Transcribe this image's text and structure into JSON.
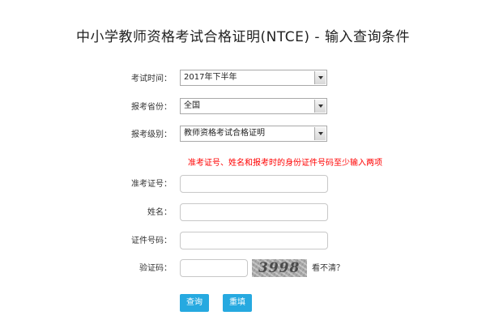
{
  "title": "中小学教师资格考试合格证明(NTCE) - 输入查询条件",
  "form": {
    "exam_time": {
      "label": "考试时间：",
      "selected": "2017年下半年"
    },
    "province": {
      "label": "报考省份：",
      "selected": "全国"
    },
    "level": {
      "label": "报考级别：",
      "selected": "教师资格考试合格证明"
    },
    "hint": "准考证号、姓名和报考时的身份证件号码至少输入两项",
    "ticket_no": {
      "label": "准考证号：",
      "value": ""
    },
    "name": {
      "label": "姓名：",
      "value": ""
    },
    "id_no": {
      "label": "证件号码：",
      "value": ""
    },
    "captcha": {
      "label": "验证码：",
      "value": "",
      "image_text": "3998",
      "refresh_label": "看不清？"
    }
  },
  "buttons": {
    "query_label": "查询",
    "reset_label": "重填"
  },
  "colors": {
    "button": "#26a9e0",
    "hint": "#ff0000"
  },
  "icons": {
    "dropdown": "chevron-down-icon"
  }
}
